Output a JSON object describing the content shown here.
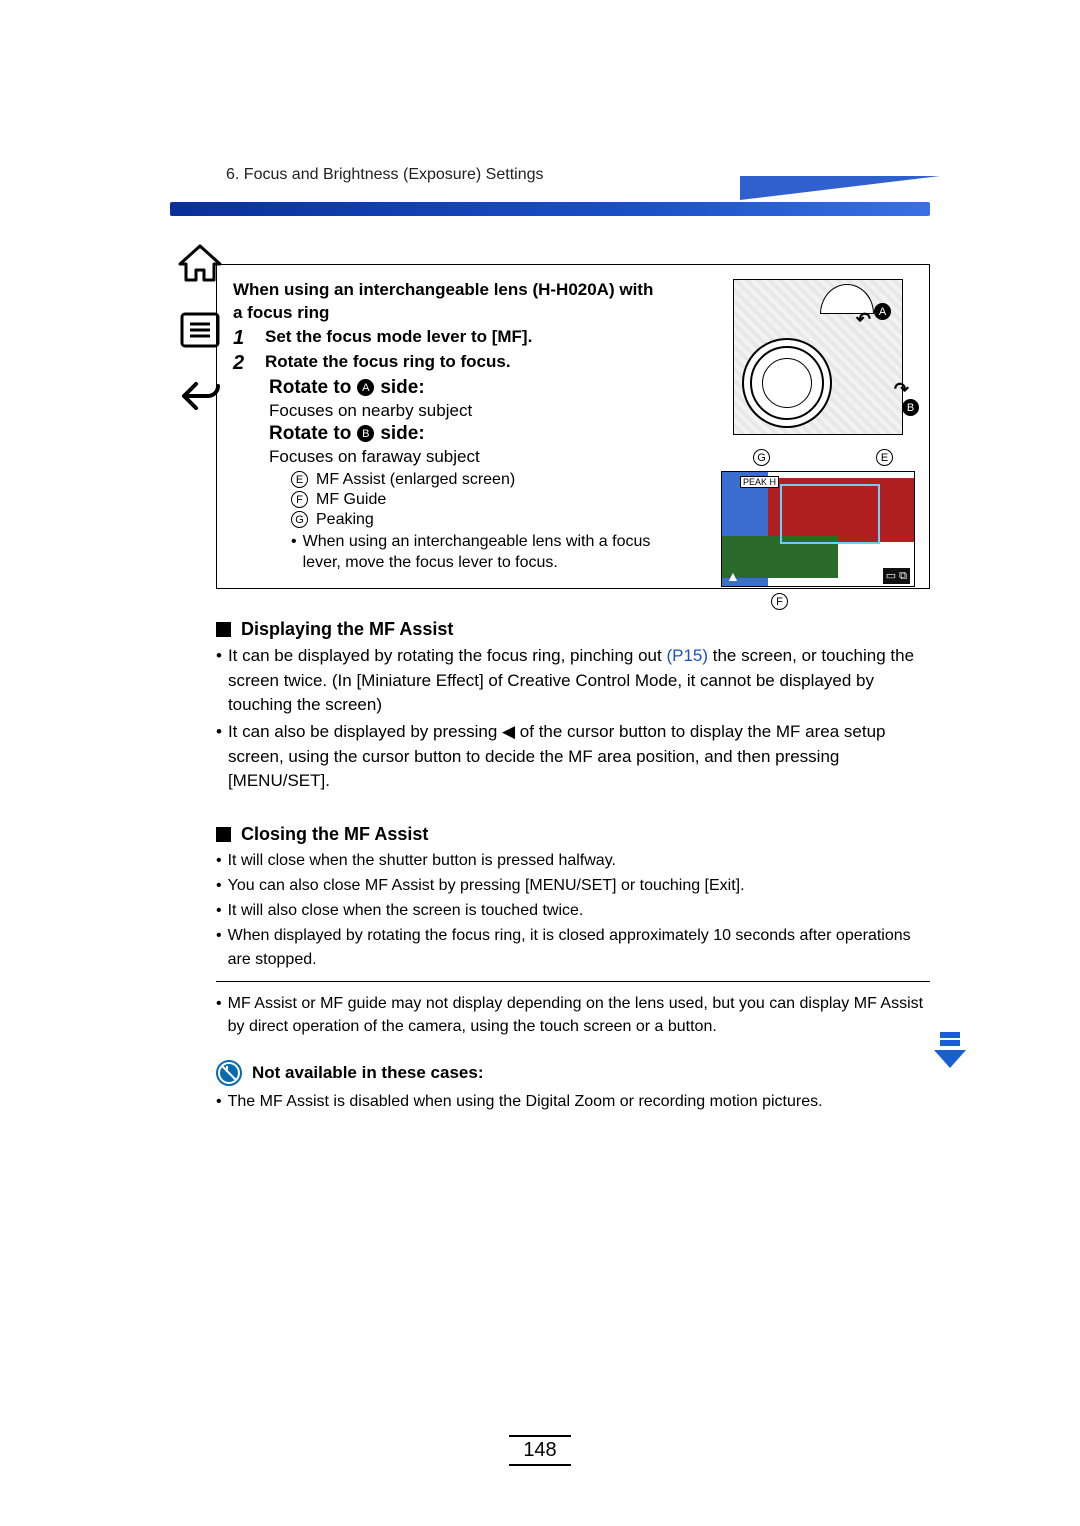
{
  "header": {
    "chapter": "6. Focus and Brightness (Exposure) Settings"
  },
  "nav": {
    "home_label": "home",
    "toc_label": "table-of-contents",
    "back_label": "back"
  },
  "box": {
    "intro_line1": "When using an interchangeable lens (H-H020A) with",
    "intro_line2": "a focus ring",
    "step1_num": "1",
    "step1_text": "Set the focus mode lever to [MF].",
    "step2_num": "2",
    "step2_text": "Rotate the focus ring to focus.",
    "rotate_a_prefix": "Rotate to",
    "rotate_a_marker": "A",
    "rotate_a_suffix": "side:",
    "rotate_a_desc": "Focuses on nearby subject",
    "rotate_b_prefix": "Rotate to",
    "rotate_b_marker": "B",
    "rotate_b_suffix": "side:",
    "rotate_b_desc": "Focuses on faraway subject",
    "legend": [
      {
        "letter": "E",
        "text": "MF Assist (enlarged screen)"
      },
      {
        "letter": "F",
        "text": "MF Guide"
      },
      {
        "letter": "G",
        "text": "Peaking"
      }
    ],
    "lever_note": "When using an interchangeable lens with a focus lever, move the focus lever to focus.",
    "illus": {
      "A": "A",
      "B": "B",
      "E": "E",
      "F": "F",
      "G": "G",
      "peak_badge": "PEAK H"
    }
  },
  "displaying": {
    "title": "Displaying the MF Assist",
    "items": [
      {
        "pre": "It can be displayed by rotating the focus ring, pinching out ",
        "link": "(P15)",
        "post": " the screen, or touching the screen twice. (In [Miniature Effect] of Creative Control Mode, it cannot be displayed by touching the screen)"
      },
      {
        "full": "It can also be displayed by pressing ◀ of the cursor button to display the MF area setup screen, using the cursor button to decide the MF area position, and then pressing [MENU/SET]."
      }
    ]
  },
  "closing": {
    "title": "Closing the MF Assist",
    "items": [
      "It will close when the shutter button is pressed halfway.",
      "You can also close MF Assist by pressing [MENU/SET] or touching [Exit].",
      "It will also close when the screen is touched twice.",
      "When displayed by rotating the focus ring, it is closed approximately 10 seconds after operations are stopped."
    ]
  },
  "note_after_hr": "MF Assist or MF guide may not display depending on the lens used, but you can display MF Assist by direct operation of the camera, using the touch screen or a button.",
  "not_available": {
    "title": "Not available in these cases:",
    "item": "The MF Assist is disabled when using the Digital Zoom or recording motion pictures."
  },
  "page_number": "148"
}
